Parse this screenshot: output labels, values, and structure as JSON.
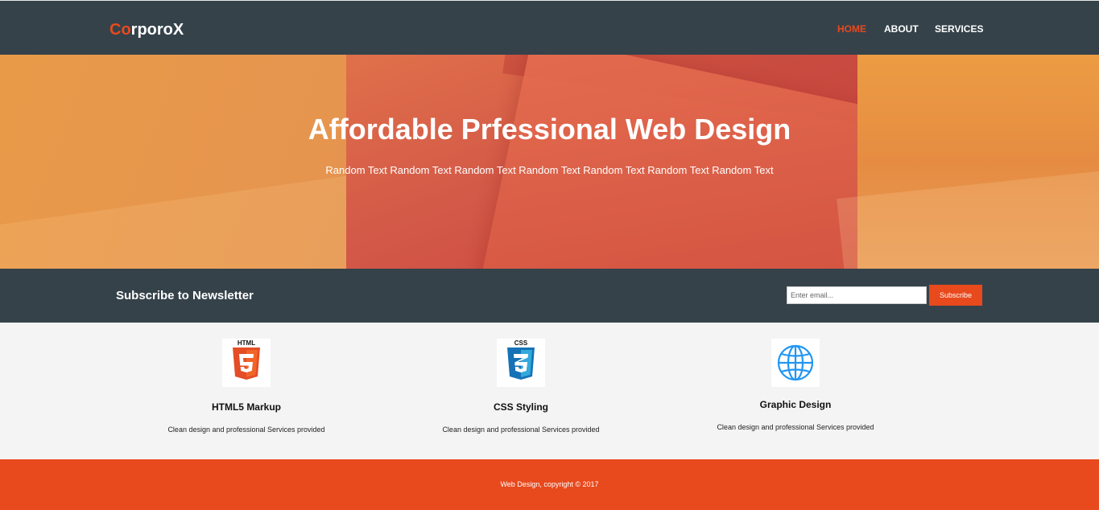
{
  "header": {
    "logo_highlight": "Co",
    "logo_rest": "rporoX",
    "nav": [
      {
        "label": "HOME",
        "active": true
      },
      {
        "label": "ABOUT",
        "active": false
      },
      {
        "label": "SERVICES",
        "active": false
      }
    ]
  },
  "showcase": {
    "title": "Affordable Prfessional Web Design",
    "subtitle": "Random Text Random Text Random Text Random Text Random Text Random Text Random Text"
  },
  "newsletter": {
    "title": "Subscribe to Newsletter",
    "email_placeholder": "Enter email...",
    "button_label": "Subscribe"
  },
  "boxes": [
    {
      "icon": "html5-icon",
      "title": "HTML5 Markup",
      "text": "Clean design and professional Services provided"
    },
    {
      "icon": "css3-icon",
      "title": "CSS Styling",
      "text": "Clean design and professional Services provided"
    },
    {
      "icon": "globe-icon",
      "title": "Graphic Design",
      "text": "Clean design and professional Services provided"
    }
  ],
  "footer": {
    "text": "Web Design, copyright © 2017"
  },
  "colors": {
    "dark": "#35424a",
    "accent": "#e8491d",
    "light_bg": "#f4f4f4"
  }
}
